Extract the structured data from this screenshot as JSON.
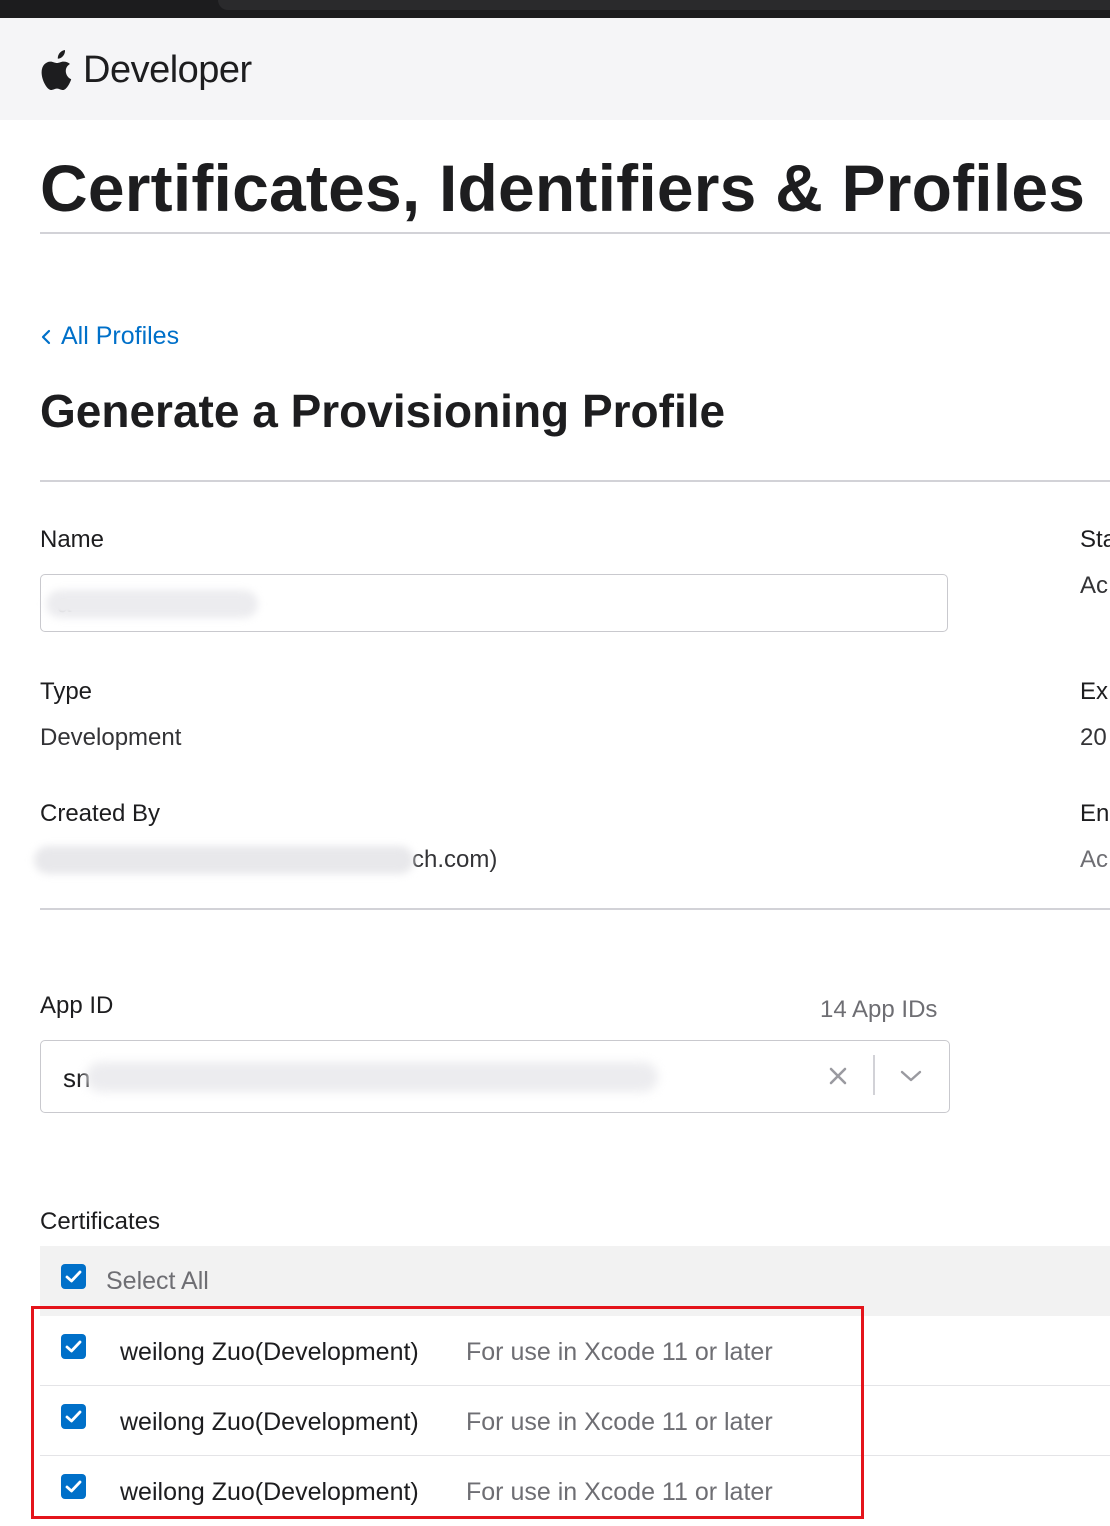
{
  "header": {
    "brand_name": "Developer"
  },
  "page": {
    "title": "Certificates, Identifiers & Profiles"
  },
  "nav": {
    "back_link": "All Profiles"
  },
  "form": {
    "title": "Generate a Provisioning Profile",
    "name": {
      "label": "Name",
      "value": "a"
    },
    "type": {
      "label": "Type",
      "value": "Development"
    },
    "created_by": {
      "label": "Created By",
      "value": "ch.com)"
    },
    "right_column": [
      {
        "label": "Sta",
        "value": "Ac"
      },
      {
        "label": "Ex",
        "value": "20"
      },
      {
        "label": "En",
        "value": "Ac"
      }
    ],
    "app_id": {
      "label": "App ID",
      "count": "14 App IDs",
      "value": "sn"
    },
    "certificates": {
      "label": "Certificates",
      "select_all": {
        "label": "Select All",
        "checked": true
      },
      "items": [
        {
          "name": "weilong Zuo(Development)",
          "note": "For use in Xcode 11 or later",
          "checked": true
        },
        {
          "name": "weilong Zuo(Development)",
          "note": "For use in Xcode 11 or later",
          "checked": true
        },
        {
          "name": "weilong Zuo(Development)",
          "note": "For use in Xcode 11 or later",
          "checked": true
        }
      ]
    }
  },
  "colors": {
    "link": "#0070c9",
    "checkbox": "#0070c9",
    "highlight": "#e4141b",
    "text": "#1d1d1f",
    "muted": "#6e6e73"
  },
  "icons": [
    "apple-logo-icon",
    "chevron-left-icon",
    "clear-icon",
    "chevron-down-icon",
    "checkmark-icon"
  ]
}
